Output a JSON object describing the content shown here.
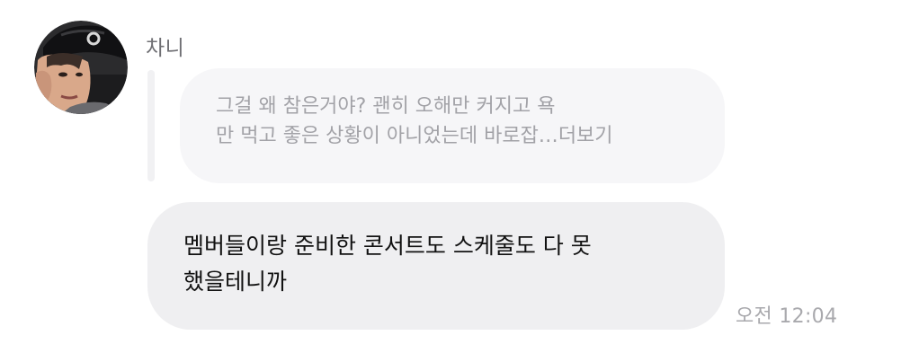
{
  "message": {
    "sender_name": "차니",
    "avatar_icon": "profile-photo-icon",
    "reply_preview": {
      "line1": "그걸 왜 참은거야? 괜히 오해만 커지고 욕",
      "line2": "만 먹고 좋은 상황이 아니었는데 바로잡…",
      "more_label": "더보기"
    },
    "body": {
      "line1": "멤버들이랑 준비한 콘서트도 스케줄도 다 못",
      "line2": "했을테니까"
    },
    "timestamp": "오전 12:04"
  },
  "colors": {
    "background": "#ffffff",
    "reply_bubble": "#f6f6f8",
    "message_bubble": "#efeff1",
    "secondary_text": "#a2a2a7",
    "primary_text": "#111111"
  }
}
